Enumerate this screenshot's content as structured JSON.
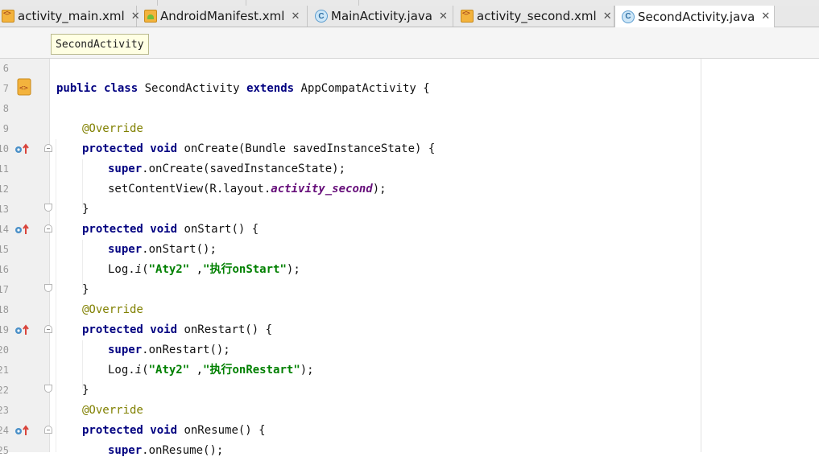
{
  "tabs": [
    {
      "label": "activity_main.xml",
      "icon": "xml-file-icon",
      "active": false
    },
    {
      "label": "AndroidManifest.xml",
      "icon": "manifest-file-icon",
      "active": false
    },
    {
      "label": "MainActivity.java",
      "icon": "java-class-icon",
      "active": false
    },
    {
      "label": "activity_second.xml",
      "icon": "xml-file-icon",
      "active": false
    },
    {
      "label": "SecondActivity.java",
      "icon": "java-class-icon",
      "active": true
    }
  ],
  "tab_close_glyph": "✕",
  "class_icon_letter": "C",
  "breadcrumb": "SecondActivity",
  "line_numbers": [
    "6",
    "7",
    "8",
    "9",
    "10",
    "11",
    "12",
    "13",
    "14",
    "15",
    "16",
    "17",
    "18",
    "19",
    "20",
    "21",
    "22",
    "23",
    "24",
    "25"
  ],
  "code": {
    "l7": {
      "kw1": "public",
      "kw2": "class",
      "name": "SecondActivity",
      "kw3": "extends",
      "parent": "AppCompatActivity {"
    },
    "l9": {
      "ann": "@Override"
    },
    "l10": {
      "kw1": "protected",
      "kw2": "void",
      "rest": "onCreate(Bundle savedInstanceState) {"
    },
    "l11": {
      "kw": "super",
      "rest": ".onCreate(savedInstanceState);"
    },
    "l12": {
      "pre": "setContentView(R.layout.",
      "field": "activity_second",
      "post": ");"
    },
    "l13": {
      "text": "}"
    },
    "l14": {
      "kw1": "protected",
      "kw2": "void",
      "rest": "onStart() {"
    },
    "l15": {
      "kw": "super",
      "rest": ".onStart();"
    },
    "l16": {
      "pre": "Log.",
      "method": "i",
      "open": "(",
      "s1": "\"Aty2\"",
      "sep": " ,",
      "s2": "\"执行onStart\"",
      "post": ");"
    },
    "l17": {
      "text": "}"
    },
    "l18": {
      "ann": "@Override"
    },
    "l19": {
      "kw1": "protected",
      "kw2": "void",
      "rest": "onRestart() {"
    },
    "l20": {
      "kw": "super",
      "rest": ".onRestart();"
    },
    "l21": {
      "pre": "Log.",
      "method": "i",
      "open": "(",
      "s1": "\"Aty2\"",
      "sep": " ,",
      "s2": "\"执行onRestart\"",
      "post": ");"
    },
    "l22": {
      "text": "}"
    },
    "l23": {
      "ann": "@Override"
    },
    "l24": {
      "kw1": "protected",
      "kw2": "void",
      "rest": "onResume() {"
    },
    "l25": {
      "kw": "super",
      "rest": ".onResume();"
    }
  },
  "colors": {
    "keyword": "#000080",
    "annotation": "#808000",
    "string": "#008000",
    "field": "#660e7a"
  }
}
